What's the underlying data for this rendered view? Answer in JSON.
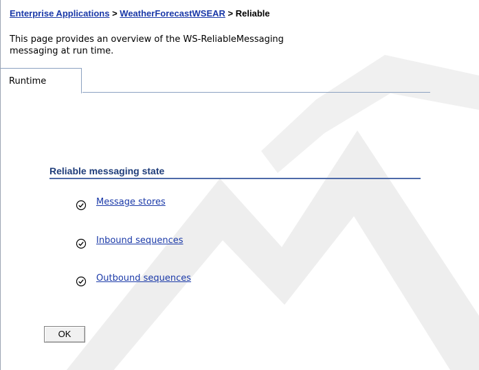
{
  "breadcrumb": {
    "items": [
      {
        "label": "Enterprise Applications",
        "link": true
      },
      {
        "label": "WeatherForecastWSEAR",
        "link": true
      },
      {
        "label": "Reliable",
        "link": false
      }
    ],
    "separator": ">"
  },
  "description": {
    "line1": "This page provides an overview of the WS-ReliableMessaging",
    "line2": "messaging at run time."
  },
  "tabs": [
    {
      "label": "Runtime",
      "selected": true
    }
  ],
  "section": {
    "title": "Reliable messaging state",
    "items": [
      {
        "label": "Message stores",
        "icon": "check-circle-icon"
      },
      {
        "label": "Inbound sequences",
        "icon": "check-circle-icon"
      },
      {
        "label": "Outbound sequences",
        "icon": "check-circle-icon"
      }
    ]
  },
  "buttons": {
    "ok_label": "OK"
  },
  "colors": {
    "link": "#1a39a8",
    "section_title": "#1f3d7a",
    "section_rule": "#4d6aa8",
    "tab_border": "#8aa0c0",
    "watermark": "#eaeaea"
  }
}
